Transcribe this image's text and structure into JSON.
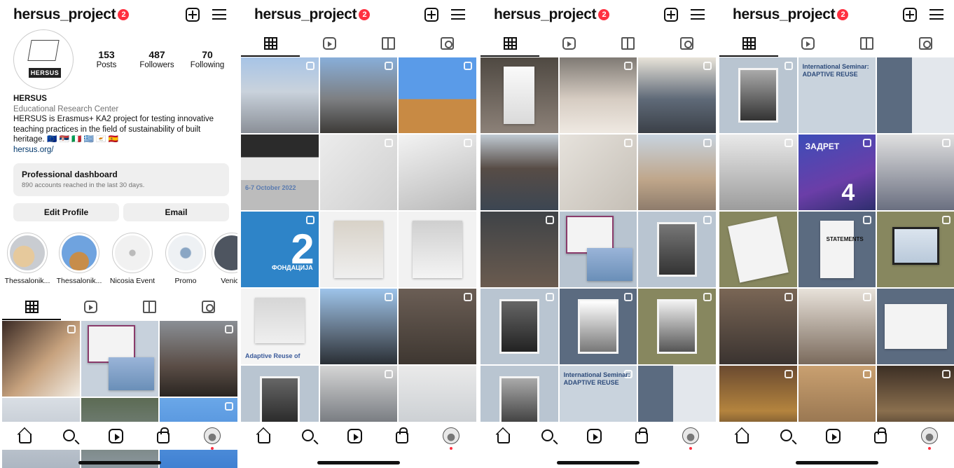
{
  "colors": {
    "accent_red": "#ff3040",
    "link": "#00376b",
    "muted": "#737373"
  },
  "icons": {
    "top": [
      "plus-square-icon",
      "hamburger-menu-icon"
    ],
    "tabs": [
      "grid-icon",
      "reels-icon",
      "guide-icon",
      "tagged-icon"
    ],
    "bottom_nav": [
      "home-icon",
      "search-icon",
      "reels-icon",
      "shop-icon",
      "profile-avatar-icon"
    ]
  },
  "profile": {
    "username": "hersus_project",
    "notification_count": "2",
    "logo_text": "HERSUS",
    "stats": [
      {
        "value": "153",
        "label": "Posts"
      },
      {
        "value": "487",
        "label": "Followers"
      },
      {
        "value": "70",
        "label": "Following"
      }
    ],
    "bio": {
      "name": "HERSUS",
      "category": "Educational Research Center",
      "text": "HERSUS is Erasmus+ KA2 project for testing innovative teaching practices in the field of sustainability of built heritage.",
      "flags": "🇪🇺 🇷🇸 🇮🇹 🇬🇷 🇨🇾 🇪🇸",
      "link": "hersus.org/"
    },
    "dashboard": {
      "title": "Professional dashboard",
      "subtitle": "890 accounts reached in the last 30 days."
    },
    "buttons": {
      "edit_profile": "Edit Profile",
      "email": "Email"
    },
    "highlights": [
      {
        "label": "Thessalonik..."
      },
      {
        "label": "Thessalonik..."
      },
      {
        "label": "Nicosia Event"
      },
      {
        "label": "Promo"
      },
      {
        "label": "Venice"
      }
    ]
  },
  "grid_texts": {
    "p2_r2_c1": "6-7 October 2022",
    "p2_r3_c1_big": "2",
    "p2_r3_c1_sub": "ФОНДАЦИЈА",
    "p2_r4_c1": "Adaptive Reuse of",
    "p3_r5_c2": "International Seminar: ADAPTIVE REUSE",
    "p4_r1_c2": "International Seminar: ADAPTIVE REUSE",
    "p4_r2_c2": "ЗАДРЕТ",
    "p4_r2_c2_num": "4",
    "p4_r3_c2": "STATEMENTS"
  }
}
